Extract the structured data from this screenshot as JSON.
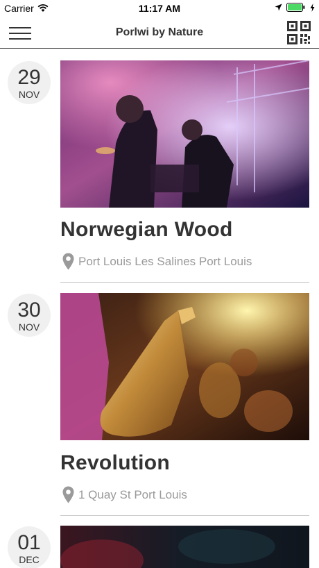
{
  "status_bar": {
    "carrier": "Carrier",
    "time": "11:17 AM",
    "battery_color": "#4cd964"
  },
  "nav": {
    "title": "Porlwi by Nature",
    "menu_icon": "hamburger-menu-icon",
    "qr_icon": "qr-code-icon"
  },
  "events": [
    {
      "day": "29",
      "month": "NOV",
      "title": "Norwegian Wood",
      "location": "Port Louis Les Salines Port Louis",
      "image": "concert-band-stage-photo"
    },
    {
      "day": "30",
      "month": "NOV",
      "title": "Revolution",
      "location": "1 Quay St Port Louis",
      "image": "saxophone-player-photo"
    },
    {
      "day": "01",
      "month": "DEC",
      "title": "",
      "location": "",
      "image": "dark-concert-photo"
    }
  ],
  "colors": {
    "text": "#333333",
    "location_text": "#9a9a9a",
    "date_badge_bg": "#f0f0f0"
  }
}
